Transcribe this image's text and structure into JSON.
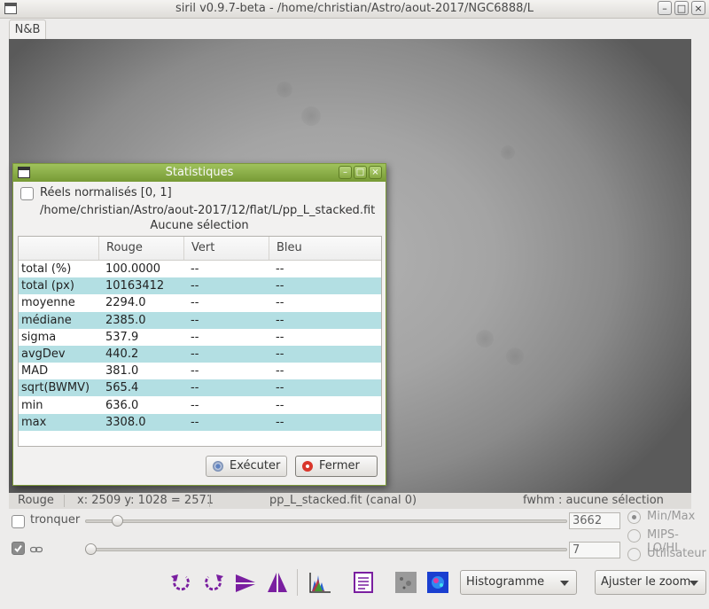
{
  "window": {
    "title": "siril v0.9.7-beta - /home/christian/Astro/aout-2017/NGC6888/L"
  },
  "tabs": [
    {
      "label": "N&B"
    }
  ],
  "dialog": {
    "title": "Statistiques",
    "normalized_label": "Réels normalisés [0, 1]",
    "normalized_checked": false,
    "file_path": "/home/christian/Astro/aout-2017/12/flat/L/pp_L_stacked.fit",
    "selection_text": "Aucune sélection",
    "columns": [
      "",
      "Rouge",
      "Vert",
      "Bleu"
    ],
    "rows": [
      {
        "name": "total (%)",
        "rouge": "100.0000",
        "vert": "--",
        "bleu": "--"
      },
      {
        "name": "total (px)",
        "rouge": "10163412",
        "vert": "--",
        "bleu": "--"
      },
      {
        "name": "moyenne",
        "rouge": "2294.0",
        "vert": "--",
        "bleu": "--"
      },
      {
        "name": "médiane",
        "rouge": "2385.0",
        "vert": "--",
        "bleu": "--"
      },
      {
        "name": "sigma",
        "rouge": "537.9",
        "vert": "--",
        "bleu": "--"
      },
      {
        "name": "avgDev",
        "rouge": "440.2",
        "vert": "--",
        "bleu": "--"
      },
      {
        "name": "MAD",
        "rouge": "381.0",
        "vert": "--",
        "bleu": "--"
      },
      {
        "name": "sqrt(BWMV)",
        "rouge": "565.4",
        "vert": "--",
        "bleu": "--"
      },
      {
        "name": "min",
        "rouge": "636.0",
        "vert": "--",
        "bleu": "--"
      },
      {
        "name": "max",
        "rouge": "3308.0",
        "vert": "--",
        "bleu": "--"
      }
    ],
    "execute_label": "Exécuter",
    "close_label": "Fermer",
    "row_alt_color": "#b3dfe3",
    "title_color": "#8db04a"
  },
  "status": {
    "channel": "Rouge",
    "coords": "x: 2509 y: 1028 = 2571",
    "filename": "pp_L_stacked.fit (canal 0)",
    "fwhm": "fwhm : aucune sélection"
  },
  "controls": {
    "truncate_label": "tronquer",
    "truncate_checked": false,
    "high_value": "3662",
    "low_value": "7",
    "link_checked": true,
    "high_slider_fraction": 0.056,
    "low_slider_fraction": 0.0,
    "radio_options": [
      "Min/Max",
      "MIPS-LO/HI",
      "Utilisateur"
    ],
    "radio_selected": "Min/Max"
  },
  "toolbar": {
    "icons": [
      "rotate-left-icon",
      "rotate-right-icon",
      "mirror-x-icon",
      "mirror-y-icon",
      "histogram-icon",
      "statistics-icon",
      "image-gray-icon",
      "image-color-icon"
    ],
    "display_mode": "Histogramme",
    "zoom_label": "Ajuster le zoom",
    "icon_color": "#7a1fa0"
  }
}
